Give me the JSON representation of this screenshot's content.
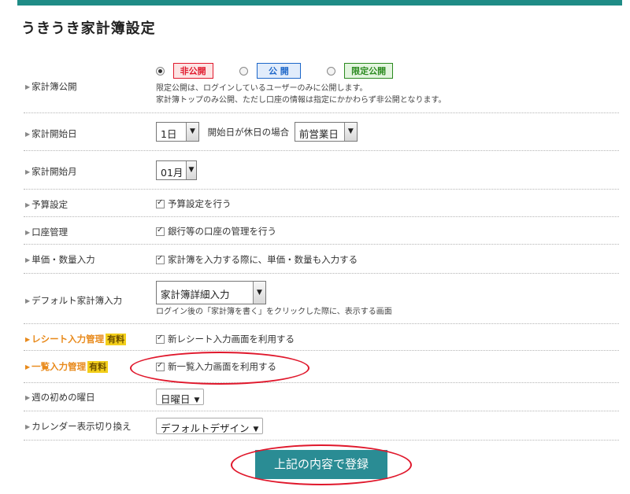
{
  "page": {
    "title": "うきうき家計簿設定"
  },
  "rows": {
    "publish": {
      "label": "家計簿公開",
      "options": [
        "非公開",
        "公 開",
        "限定公開"
      ],
      "selected": "非公開",
      "note_line1": "限定公開は、ログインしているユーザーのみに公開します。",
      "note_line2": "家計簿トップのみ公開、ただし口座の情報は指定にかかわらず非公開となります。"
    },
    "start_day": {
      "label": "家計開始日",
      "value": "1日",
      "holiday_text": "開始日が休日の場合",
      "holiday_value": "前営業日"
    },
    "start_month": {
      "label": "家計開始月",
      "value": "01月"
    },
    "budget": {
      "label": "予算設定",
      "checkbox_label": "予算設定を行う",
      "checked": true
    },
    "account": {
      "label": "口座管理",
      "checkbox_label": "銀行等の口座の管理を行う",
      "checked": true
    },
    "unit_price": {
      "label": "単価・数量入力",
      "checkbox_label": "家計簿を入力する際に、単価・数量も入力する",
      "checked": true
    },
    "default_input": {
      "label": "デフォルト家計簿入力",
      "value": "家計簿詳細入力",
      "note": "ログイン後の「家計簿を書く」をクリックした際に、表示する画面"
    },
    "receipt": {
      "label": "レシート入力管理",
      "badge": "有料",
      "checkbox_label": "新レシート入力画面を利用する",
      "checked": true
    },
    "list_input": {
      "label": "一覧入力管理",
      "badge": "有料",
      "checkbox_label": "新一覧入力画面を利用する",
      "checked": true
    },
    "week_start": {
      "label": "週の初めの曜日",
      "value": "日曜日"
    },
    "calendar": {
      "label": "カレンダー表示切り換え",
      "value": "デフォルトデザイン"
    }
  },
  "submit": {
    "label": "上記の内容で登録"
  },
  "colors": {
    "accent": "#1f8c86",
    "orange_label": "#e8891a",
    "annotation_red": "#e0182c",
    "submit_bg": "#2a8c94"
  }
}
